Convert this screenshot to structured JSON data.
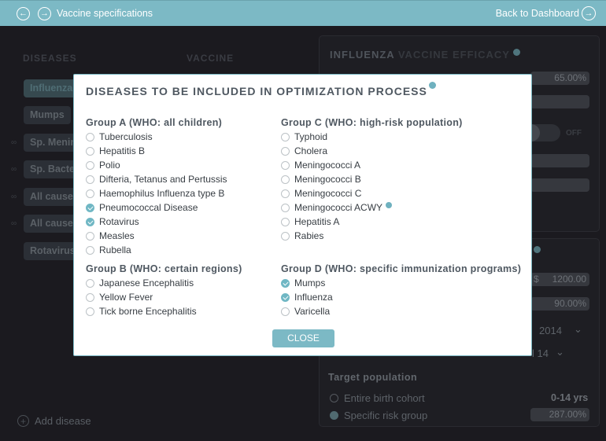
{
  "topbar": {
    "title": "Vaccine specifications",
    "back_to_dashboard": "Back to Dashboard"
  },
  "diseases_column": {
    "header": "DISEASES",
    "items": [
      {
        "label": "Influenza",
        "active": true,
        "linked": false
      },
      {
        "label": "Mumps",
        "active": false,
        "linked": false
      },
      {
        "label": "Sp. Menin",
        "active": false,
        "linked": true
      },
      {
        "label": "Sp. Bacte",
        "active": false,
        "linked": true
      },
      {
        "label": "All cause",
        "active": false,
        "linked": true
      },
      {
        "label": "All cause",
        "active": false,
        "linked": true
      },
      {
        "label": "Rotavirus",
        "active": false,
        "linked": false
      }
    ],
    "add_disease": "Add disease"
  },
  "vaccine_column": {
    "header": "VACCINE"
  },
  "efficacy_panel": {
    "title_strong": "INFLUENZA",
    "title_dim": "VACCINE EFFICACY",
    "efficacy_value": "65.00%",
    "toggle_label": "OFF",
    "toggle_on": false
  },
  "cost_panel": {
    "price_currency": "$",
    "price_value": "1200.00",
    "coverage_value": "90.00%",
    "year_value": "2014",
    "age_value": "l 14",
    "target_population": {
      "title": "Target population",
      "options": [
        {
          "label": "Entire birth cohort",
          "checked": false
        },
        {
          "label": "Specific risk group",
          "checked": true
        }
      ],
      "age_range": "0-14 yrs",
      "risk_group_value": "287.00%"
    }
  },
  "modal": {
    "title": "DISEASES TO BE INCLUDED IN OPTIMIZATION PROCESS",
    "groups": [
      {
        "title": "Group A (WHO: all children)",
        "options": [
          {
            "label": "Tuberculosis",
            "checked": false
          },
          {
            "label": "Hepatitis B",
            "checked": false
          },
          {
            "label": "Polio",
            "checked": false
          },
          {
            "label": "Difteria, Tetanus and Pertussis",
            "checked": false
          },
          {
            "label": "Haemophilus Influenza type B",
            "checked": false
          },
          {
            "label": "Pneumococcal Disease",
            "checked": true
          },
          {
            "label": "Rotavirus",
            "checked": true
          },
          {
            "label": "Measles",
            "checked": false
          },
          {
            "label": "Rubella",
            "checked": false
          }
        ]
      },
      {
        "title": "Group B (WHO: certain regions)",
        "options": [
          {
            "label": "Japanese Encephalitis",
            "checked": false
          },
          {
            "label": "Yellow Fever",
            "checked": false
          },
          {
            "label": "Tick borne Encephalitis",
            "checked": false
          }
        ]
      },
      {
        "title": "Group C (WHO: high-risk population)",
        "options": [
          {
            "label": "Typhoid",
            "checked": false
          },
          {
            "label": "Cholera",
            "checked": false
          },
          {
            "label": "Meningococci A",
            "checked": false
          },
          {
            "label": "Meningococci B",
            "checked": false
          },
          {
            "label": "Meningococci C",
            "checked": false
          },
          {
            "label": "Meningococci ACWY",
            "checked": false,
            "info": true
          },
          {
            "label": "Hepatitis A",
            "checked": false
          },
          {
            "label": "Rabies",
            "checked": false
          }
        ]
      },
      {
        "title": "Group D (WHO: specific immunization programs)",
        "options": [
          {
            "label": "Mumps",
            "checked": true
          },
          {
            "label": "Influenza",
            "checked": true
          },
          {
            "label": "Varicella",
            "checked": false
          }
        ]
      }
    ],
    "close_label": "CLOSE"
  },
  "colors": {
    "accent": "#7cb9c5",
    "background": "#1b1a1f",
    "modal_text": "#4f5861"
  }
}
